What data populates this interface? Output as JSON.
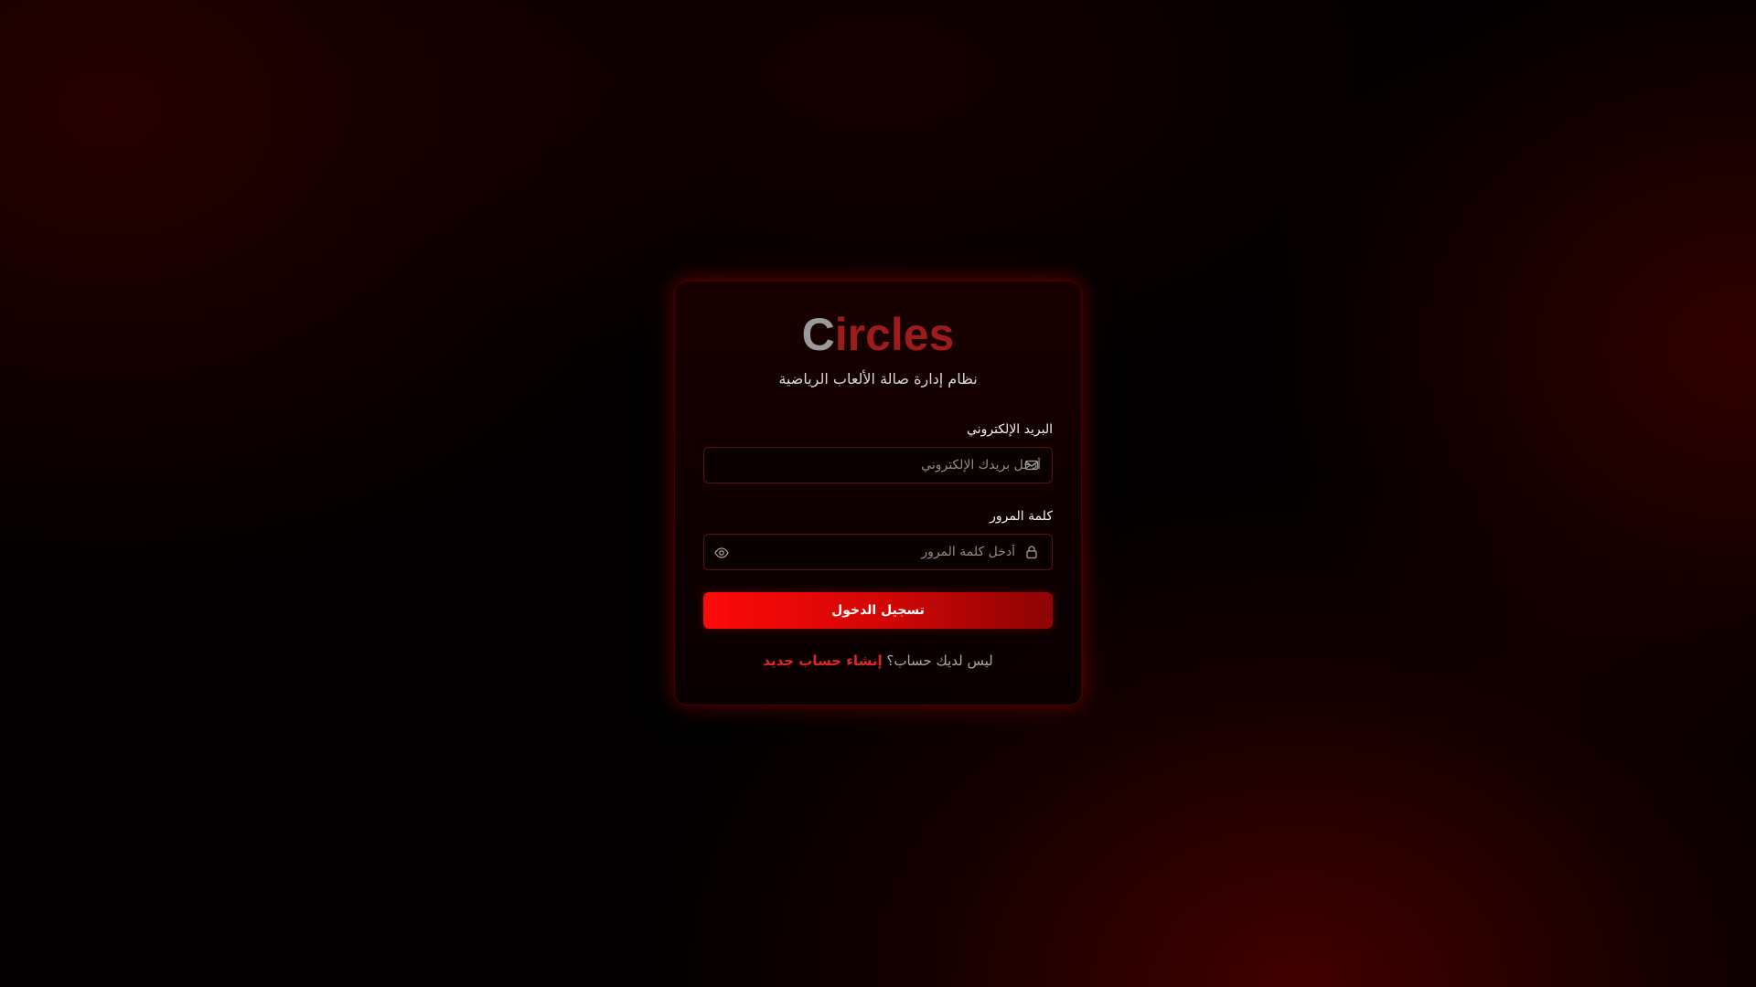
{
  "brand": {
    "first_letter": "C",
    "rest": "ircles"
  },
  "subtitle": "نظام إدارة صالة الألعاب الرياضية",
  "email": {
    "label": "البريد الإلكتروني",
    "placeholder": "أدخل بريدك الإلكتروني",
    "value": "",
    "icon": "mail-icon"
  },
  "password": {
    "label": "كلمة المرور",
    "placeholder": "أدخل كلمة المرور",
    "value": "",
    "icon": "lock-icon",
    "toggle_icon": "eye-icon"
  },
  "login_button": "تسجيل الدخول",
  "footer": {
    "prompt": "ليس لديك حساب؟",
    "register_link": "إنشاء حساب جديد"
  },
  "colors": {
    "accent": "#ff0a0a",
    "accent_dark": "#8c0404",
    "brand_red": "#9c1c1c",
    "brand_gray": "#9a9a9a",
    "link": "#e0262b"
  }
}
